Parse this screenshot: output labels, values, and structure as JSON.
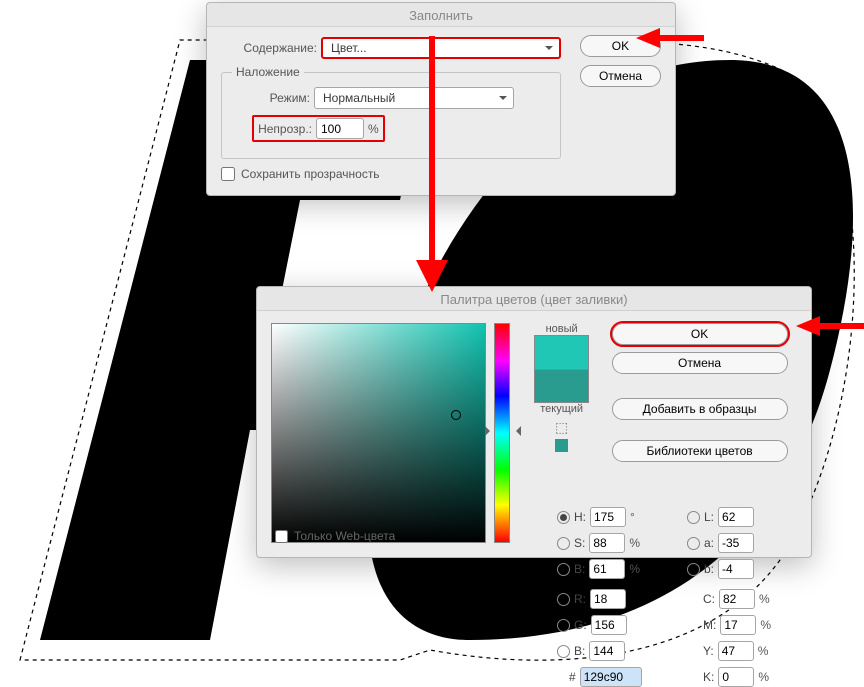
{
  "fill": {
    "title": "Заполнить",
    "content_label": "Содержание:",
    "content_value": "Цвет...",
    "blending_legend": "Наложение",
    "mode_label": "Режим:",
    "mode_value": "Нормальный",
    "opacity_label": "Непрозр.:",
    "opacity_value": "100",
    "opacity_pct": "%",
    "preserve_label": "Сохранить прозрачность",
    "ok": "OK",
    "cancel": "Отмена"
  },
  "picker": {
    "title": "Палитра цветов (цвет заливки)",
    "new_label": "новый",
    "current_label": "текущий",
    "ok": "OK",
    "cancel": "Отмена",
    "add_swatch": "Добавить в образцы",
    "libraries": "Библиотеки цветов",
    "web_only": "Только Web-цвета",
    "H_label": "H:",
    "H_val": "175",
    "H_unit": "°",
    "S_label": "S:",
    "S_val": "88",
    "S_unit": "%",
    "Bv_label": "B:",
    "Bv_val": "61",
    "Bv_unit": "%",
    "R_label": "R:",
    "R_val": "18",
    "G_label": "G:",
    "G_val": "156",
    "B_label": "B:",
    "B_val": "144",
    "L_label": "L:",
    "L_val": "62",
    "a_label": "a:",
    "a_val": "-35",
    "b_label": "b:",
    "b_val": "-4",
    "C_label": "C:",
    "C_val": "82",
    "C_unit": "%",
    "M_label": "M:",
    "M_val": "17",
    "M_unit": "%",
    "Y_label": "Y:",
    "Y_val": "47",
    "Y_unit": "%",
    "K_label": "K:",
    "K_val": "0",
    "K_unit": "%",
    "hash": "#",
    "hex": "129c90"
  }
}
